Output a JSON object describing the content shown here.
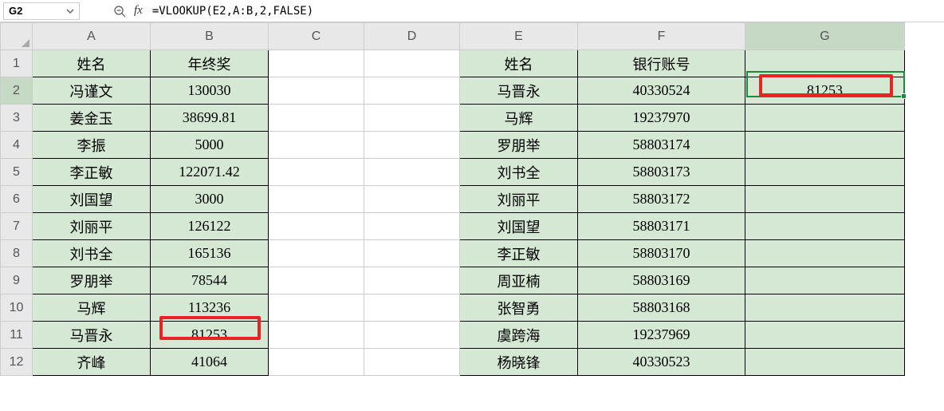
{
  "nameBox": "G2",
  "formula": "=VLOOKUP(E2,A:B,2,FALSE)",
  "fxLabel": "fx",
  "columns": [
    "A",
    "B",
    "C",
    "D",
    "E",
    "F",
    "G"
  ],
  "rowNums": [
    "1",
    "2",
    "3",
    "4",
    "5",
    "6",
    "7",
    "8",
    "9",
    "10",
    "11",
    "12"
  ],
  "headers": {
    "A1": "姓名",
    "B1": "年终奖",
    "E1": "姓名",
    "F1": "银行账号"
  },
  "colAB": [
    {
      "a": "冯谨文",
      "b": "130030"
    },
    {
      "a": "姜金玉",
      "b": "38699.81"
    },
    {
      "a": "李振",
      "b": "5000"
    },
    {
      "a": "李正敏",
      "b": "122071.42"
    },
    {
      "a": "刘国望",
      "b": "3000"
    },
    {
      "a": "刘丽平",
      "b": "126122"
    },
    {
      "a": "刘书全",
      "b": "165136"
    },
    {
      "a": "罗朋举",
      "b": "78544"
    },
    {
      "a": "马辉",
      "b": "113236"
    },
    {
      "a": "马晋永",
      "b": "81253"
    },
    {
      "a": "齐峰",
      "b": "41064"
    }
  ],
  "colEF": [
    {
      "e": "马晋永",
      "f": "40330524"
    },
    {
      "e": "马辉",
      "f": "19237970"
    },
    {
      "e": "罗朋举",
      "f": "58803174"
    },
    {
      "e": "刘书全",
      "f": "58803173"
    },
    {
      "e": "刘丽平",
      "f": "58803172"
    },
    {
      "e": "刘国望",
      "f": "58803171"
    },
    {
      "e": "李正敏",
      "f": "58803170"
    },
    {
      "e": "周亚楠",
      "f": "58803169"
    },
    {
      "e": "张智勇",
      "f": "58803168"
    },
    {
      "e": "虞跨海",
      "f": "19237969"
    },
    {
      "e": "杨晓锋",
      "f": "40330523"
    }
  ],
  "G2": "81253",
  "activeCellRef": "G2"
}
